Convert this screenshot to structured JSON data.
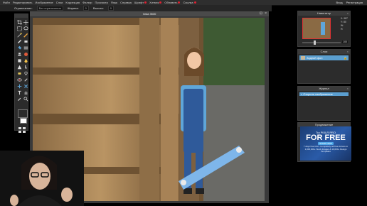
{
  "menubar": {
    "items": [
      "Файл",
      "Редактировать",
      "Изображение",
      "Слои",
      "Коррекция",
      "Фильтр",
      "Просмотр",
      "Язык",
      "Справка",
      "Шрифт",
      "Хитмэк",
      "Обновить",
      "Ссылка"
    ],
    "right": [
      "Вход",
      "Регистрация"
    ]
  },
  "optionsbar": {
    "constraint_label": "Ограничение:",
    "constraint_value": "Без ограничения",
    "width_label": "Ширина:",
    "width_value": "0",
    "height_label": "Высота:",
    "height_value": "0"
  },
  "canvas": {
    "title": "Insta 3530"
  },
  "navigator": {
    "title": "Навигатор",
    "x_label": "X:",
    "x_value": "987",
    "y_label": "Y:",
    "y_value": "80",
    "w_label": "W:",
    "h_label": "H:",
    "zoom": "100"
  },
  "layers": {
    "title": "Слои",
    "items": [
      "Задний фон"
    ]
  },
  "history": {
    "title": "Журнал",
    "items": [
      "Открыть изображение"
    ]
  },
  "promo": {
    "title": "Продвижение",
    "line1": "Try PIXLR PRO",
    "headline1": "FOR",
    "headline2": "FREE",
    "button": "START NOW",
    "body": "7 days free trial • Completely ad-free Access to 1,000,000+ Stock Images & 10,000+ Design Templates"
  },
  "colors": {
    "accent": "#5b9fd0",
    "foreground_swatch": "#000000",
    "background_swatch": "#ffffff"
  }
}
